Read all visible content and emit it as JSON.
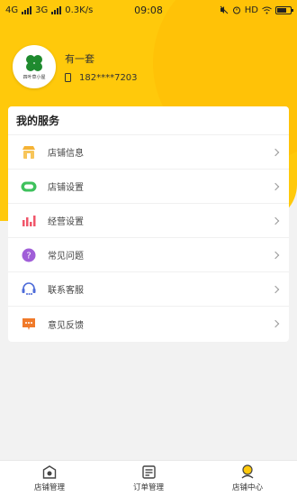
{
  "status_bar": {
    "network1": "4G",
    "network2": "3G",
    "speed": "0.3K/s",
    "time": "09:08",
    "hd": "HD"
  },
  "profile": {
    "avatar_text": "四叶草小屋",
    "store_name": "有一套",
    "phone": "182****7203"
  },
  "services": {
    "title": "我的服务",
    "items": [
      {
        "label": "店铺信息",
        "icon": "store-info-icon",
        "color": "#f5b335"
      },
      {
        "label": "店铺设置",
        "icon": "store-settings-icon",
        "color": "#3ec15c"
      },
      {
        "label": "经营设置",
        "icon": "business-settings-icon",
        "color": "#f0566a"
      },
      {
        "label": "常见问题",
        "icon": "faq-icon",
        "color": "#a05ed8"
      },
      {
        "label": "联系客服",
        "icon": "customer-service-icon",
        "color": "#4d6bd8"
      },
      {
        "label": "意见反馈",
        "icon": "feedback-icon",
        "color": "#f07a2a"
      }
    ]
  },
  "tabbar": {
    "items": [
      {
        "label": "店铺管理",
        "icon": "store-manage-icon"
      },
      {
        "label": "订单管理",
        "icon": "order-manage-icon"
      },
      {
        "label": "店铺中心",
        "icon": "store-center-icon",
        "active": true
      }
    ]
  },
  "colors": {
    "accent": "#ffc90b",
    "background": "#f2f2f2"
  }
}
